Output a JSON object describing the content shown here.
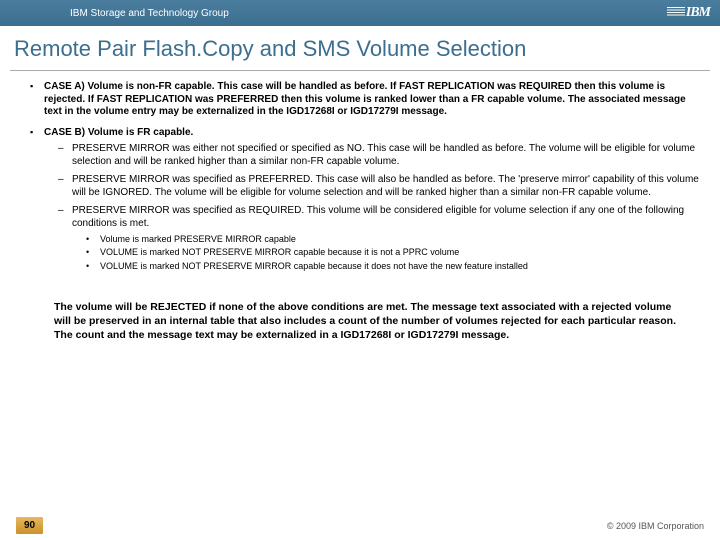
{
  "header": {
    "group": "IBM Storage and Technology Group",
    "logo_text": "IBM"
  },
  "title": "Remote Pair Flash.Copy and SMS Volume Selection",
  "caseA": {
    "label": "CASE A) Volume is non-FR capable. This case will be handled as before. If FAST REPLICATION was REQUIRED then this volume is rejected. If FAST REPLICATION was PREFERRED then this volume is ranked lower than a FR capable volume. The associated message text in the volume entry may be externalized in the IGD17268I or IGD17279I message."
  },
  "caseB": {
    "label": "CASE B) Volume is FR capable.",
    "sub1": "PRESERVE MIRROR was either not specified or specified as NO. This case will be handled as before. The volume will be eligible for volume selection and will be ranked higher than a similar non-FR capable volume.",
    "sub2": "PRESERVE MIRROR was specified as PREFERRED. This case will also be handled as before. The 'preserve mirror' capability of this volume will be IGNORED. The volume will be eligible for volume selection and will be ranked higher than a similar non-FR capable volume.",
    "sub3": "PRESERVE MIRROR was specified as REQUIRED. This volume will be considered eligible for volume selection if any one of the following conditions is met.",
    "cond1": "Volume is marked PRESERVE MIRROR capable",
    "cond2": "VOLUME is marked NOT PRESERVE MIRROR capable because it is not a PPRC volume",
    "cond3": "VOLUME is marked NOT PRESERVE MIRROR capable because it does not have the new feature installed"
  },
  "rejected": "The volume will be REJECTED if none of the above conditions are met. The message text associated with a rejected volume will be preserved in an internal table that also includes a count of the number of volumes rejected for each particular reason. The count and the message text may be externalized in a IGD17268I or IGD17279I message.",
  "footer": {
    "page": "90",
    "copyright": "© 2009 IBM Corporation"
  }
}
